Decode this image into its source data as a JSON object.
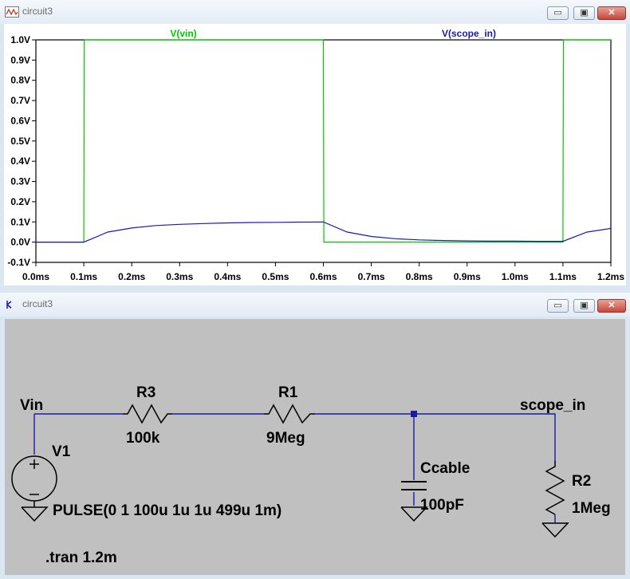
{
  "plot_window": {
    "title": "circuit3",
    "traces": [
      {
        "name": "V(vin)",
        "color": "#00c800"
      },
      {
        "name": "V(scope_in)",
        "color": "#1a1aa8"
      }
    ]
  },
  "schematic_window": {
    "title": "circuit3",
    "nets": {
      "vin": "Vin",
      "scope_in": "scope_in"
    },
    "components": {
      "v1": {
        "name": "V1",
        "value": "PULSE(0 1 100u 1u 1u 499u 1m)"
      },
      "r3": {
        "name": "R3",
        "value": "100k"
      },
      "r1": {
        "name": "R1",
        "value": "9Meg"
      },
      "ccable": {
        "name": "Ccable",
        "value": "100pF"
      },
      "r2": {
        "name": "R2",
        "value": "1Meg"
      }
    },
    "directive": ".tran 1.2m",
    "wire_color": "#1a1aa8"
  },
  "chart_data": {
    "type": "line",
    "xlabel": "",
    "ylabel": "",
    "xlim": [
      0,
      1.2
    ],
    "ylim": [
      -0.1,
      1.0
    ],
    "x_ticks": [
      "0.0ms",
      "0.1ms",
      "0.2ms",
      "0.3ms",
      "0.4ms",
      "0.5ms",
      "0.6ms",
      "0.7ms",
      "0.8ms",
      "0.9ms",
      "1.0ms",
      "1.1ms",
      "1.2ms"
    ],
    "y_ticks": [
      "-0.1V",
      "0.0V",
      "0.1V",
      "0.2V",
      "0.3V",
      "0.4V",
      "0.5V",
      "0.6V",
      "0.7V",
      "0.8V",
      "0.9V",
      "1.0V"
    ],
    "series": [
      {
        "name": "V(vin)",
        "color": "#00c800",
        "x": [
          0,
          0.1,
          0.101,
          0.6,
          0.601,
          1.1,
          1.101,
          1.2
        ],
        "y": [
          0,
          0,
          1,
          1,
          0,
          0,
          1,
          1
        ]
      },
      {
        "name": "V(scope_in)",
        "color": "#1a1aa8",
        "x": [
          0,
          0.1,
          0.15,
          0.2,
          0.25,
          0.3,
          0.35,
          0.4,
          0.45,
          0.5,
          0.55,
          0.6,
          0.65,
          0.7,
          0.75,
          0.8,
          0.85,
          0.9,
          0.95,
          1.0,
          1.05,
          1.1,
          1.15,
          1.2
        ],
        "y": [
          0,
          0,
          0.05,
          0.07,
          0.082,
          0.088,
          0.092,
          0.095,
          0.097,
          0.098,
          0.099,
          0.1,
          0.05,
          0.028,
          0.017,
          0.011,
          0.008,
          0.006,
          0.005,
          0.005,
          0.004,
          0.004,
          0.05,
          0.068
        ]
      }
    ]
  }
}
